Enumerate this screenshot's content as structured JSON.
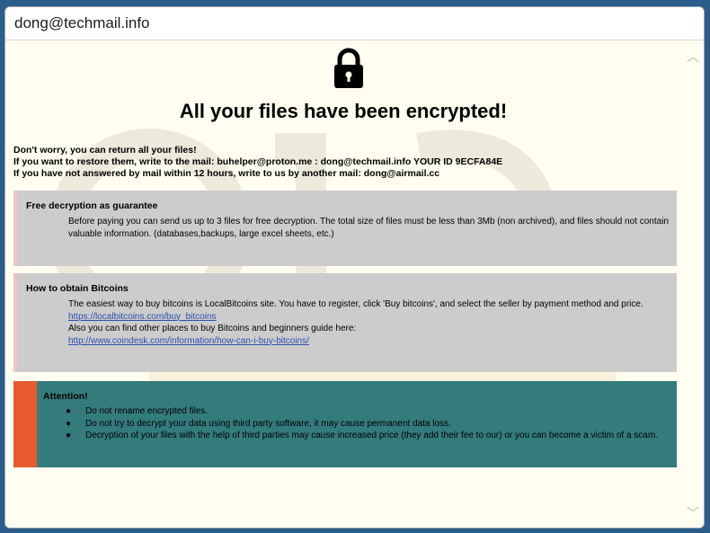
{
  "window": {
    "title": "dong@techmail.info"
  },
  "main": {
    "lock_icon": "padlock-icon",
    "headline": "All your files have been encrypted!",
    "intro_lines": [
      "Don't worry, you can return all your files!",
      "If you want to restore them, write to the mail: buhelper@proton.me :    dong@techmail.info    YOUR ID 9ECFA84E",
      "If you have not answered by mail within 12 hours, write to us by another mail:  dong@airmail.cc"
    ]
  },
  "free_decryption": {
    "title": "Free decryption as guarantee",
    "body": "Before paying you can send us up to 3 files for free decryption. The total size of files must be less than 3Mb (non archived), and files should not contain valuable information. (databases,backups, large excel sheets, etc.)"
  },
  "bitcoins": {
    "title": "How to obtain Bitcoins",
    "line1": "The easiest way to buy bitcoins is LocalBitcoins site. You have to register, click 'Buy bitcoins', and select the seller by payment method and price.",
    "link1": "https://localbitcoins.com/buy_bitcoins",
    "line2": "Also you can find other places to buy Bitcoins and beginners guide here:",
    "link2": "http://www.coindesk.com/information/how-can-i-buy-bitcoins/"
  },
  "attention": {
    "title": "Attention!",
    "items": [
      "Do not rename encrypted files.",
      "Do not try to decrypt your data using third party software, it may cause permanent data loss.",
      "Decryption of your files with the help of third parties may cause increased price (they add their fee to our) or you can become a victim of a scam."
    ],
    "bullet": "●"
  },
  "scrollbar": {
    "up_icon": "chevron-up-icon",
    "down_icon": "chevron-down-icon",
    "up_glyph": "︿",
    "down_glyph": "﹀"
  },
  "colors": {
    "content_bg": "#fffef0",
    "panel_bg": "#cccccc",
    "panel_accent": "#f2c2c6",
    "attention_bg": "#347b7c",
    "attention_bar": "#e65a2d",
    "link": "#2b4fb0"
  }
}
